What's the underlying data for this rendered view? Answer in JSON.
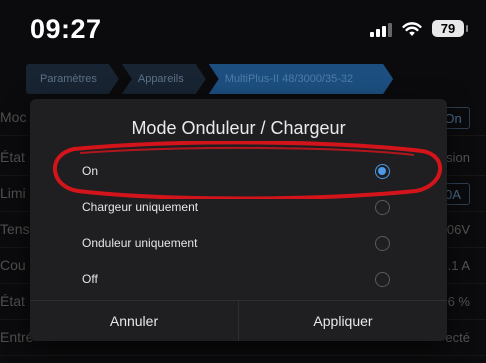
{
  "status_bar": {
    "time": "09:27",
    "battery": "79",
    "signal_icon": "cellular-signal-icon",
    "wifi_icon": "wifi-icon"
  },
  "breadcrumb": [
    "Paramètres",
    "Appareils",
    "MultiPlus-II 48/3000/35-32"
  ],
  "background_rows": [
    {
      "left": "Moc",
      "right": "On",
      "right_is_button": true
    },
    {
      "left": "État",
      "right": "sion",
      "right_is_button": false
    },
    {
      "left": "Limi",
      "right": "0A",
      "right_is_button": true
    },
    {
      "left": "Tens",
      "right": "06V",
      "right_is_button": false
    },
    {
      "left": "Cou",
      "right": ".1 A",
      "right_is_button": false
    },
    {
      "left": "État",
      "right": "56 %",
      "right_is_button": false
    },
    {
      "left": "Entré",
      "right": "ecté",
      "right_is_button": false
    }
  ],
  "dialog": {
    "title": "Mode Onduleur / Chargeur",
    "options": [
      {
        "label": "On",
        "selected": true
      },
      {
        "label": "Chargeur uniquement",
        "selected": false
      },
      {
        "label": "Onduleur uniquement",
        "selected": false
      },
      {
        "label": "Off",
        "selected": false
      }
    ],
    "cancel_label": "Annuler",
    "apply_label": "Appliquer"
  },
  "colors": {
    "accent": "#4c9ae8",
    "annotation": "#d4141b",
    "breadcrumb_active": "#1c4f80"
  }
}
